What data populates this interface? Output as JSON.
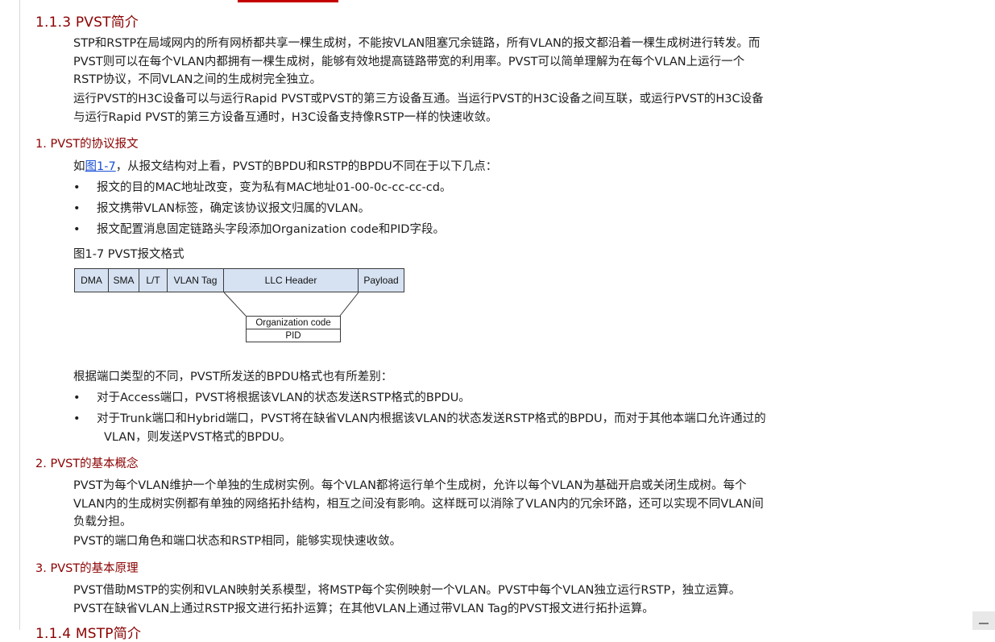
{
  "section_113": {
    "title": "1.1.3  PVST简介"
  },
  "intro": {
    "p1": [
      "STP和RSTP在局域网内的所有网桥都共享一棵生成树，不能按VLAN阻塞冗余链路，所有VLAN的报文都沿着一棵生成树进行转发。而",
      "PVST则可以在每个VLAN内都拥有一棵生成树，能够有效地提高链路带宽的利用率。PVST可以简单理解为在每个VLAN上运行一个",
      "RSTP协议，不同VLAN之间的生成树完全独立。"
    ],
    "p2": [
      "运行PVST的H3C设备可以与运行Rapid PVST或PVST的第三方设备互通。当运行PVST的H3C设备之间互联，或运行PVST的H3C设备",
      "与运行Rapid PVST的第三方设备互通时，H3C设备支持像RSTP一样的快速收敛。"
    ]
  },
  "sec1": {
    "title": "1. PVST的协议报文",
    "lead_prefix": "如",
    "lead_link": "图1-7",
    "lead_suffix": "，从报文结构对上看，PVST的BPDU和RSTP的BPDU不同在于以下几点：",
    "bullet_char": "•",
    "bullets": [
      "报文的目的MAC地址改变，变为私有MAC地址01-00-0c-cc-cc-cd。",
      "报文携带VLAN标签，确定该协议报文归属的VLAN。",
      "报文配置消息固定链路头字段添加Organization code和PID字段。"
    ],
    "figure_caption": "图1-7 PVST报文格式",
    "figure": {
      "fields": [
        "DMA",
        "SMA",
        "L/T",
        "VLAN Tag",
        "LLC Header",
        "Payload"
      ],
      "sub_fields": [
        "Organization code",
        "PID"
      ]
    },
    "after_lead": "根据端口类型的不同，PVST所发送的BPDU格式也有所差别：",
    "after_bullets": [
      [
        "对于Access端口，PVST将根据该VLAN的状态发送RSTP格式的BPDU。"
      ],
      [
        "对于Trunk端口和Hybrid端口，PVST将在缺省VLAN内根据该VLAN的状态发送RSTP格式的BPDU，而对于其他本端口允许通过的",
        "VLAN，则发送PVST格式的BPDU。"
      ]
    ]
  },
  "sec2": {
    "title": "2. PVST的基本概念",
    "p1": [
      "PVST为每个VLAN维护一个单独的生成树实例。每个VLAN都将运行单个生成树，允许以每个VLAN为基础开启或关闭生成树。每个",
      "VLAN内的生成树实例都有单独的网络拓扑结构，相互之间没有影响。这样既可以消除了VLAN内的冗余环路，还可以实现不同VLAN间",
      "负载分担。"
    ],
    "p2": "PVST的端口角色和端口状态和RSTP相同，能够实现快速收敛。"
  },
  "sec3": {
    "title": "3. PVST的基本原理",
    "p1": [
      "PVST借助MSTP的实例和VLAN映射关系模型，将MSTP每个实例映射一个VLAN。PVST中每个VLAN独立运行RSTP，独立运算。",
      "PVST在缺省VLAN上通过RSTP报文进行拓扑运算；在其他VLAN上通过带VLAN Tag的PVST报文进行拓扑运算。"
    ]
  },
  "section_114": {
    "title": "1.1.4  MSTP简介"
  }
}
